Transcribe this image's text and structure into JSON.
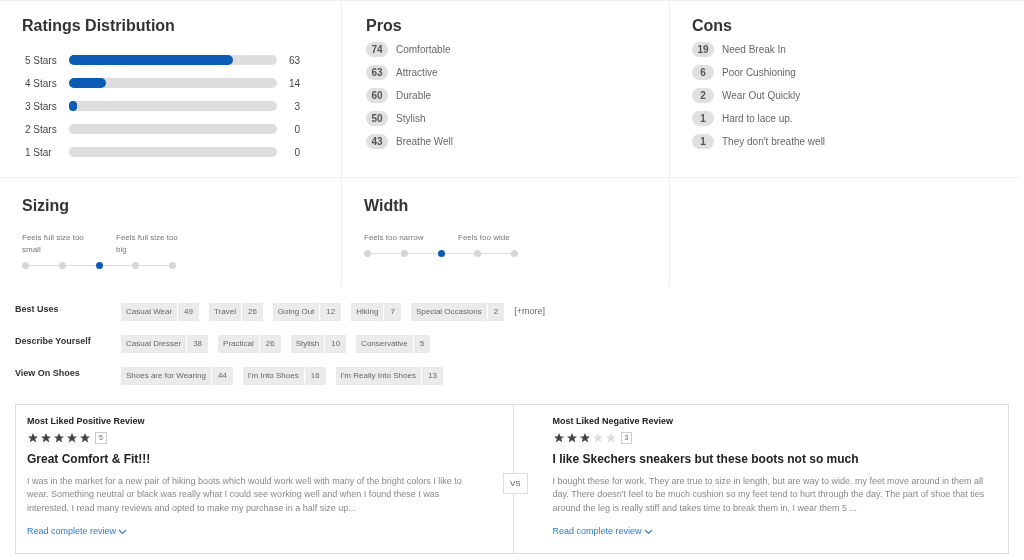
{
  "ratings": {
    "title": "Ratings Distribution",
    "rows": [
      {
        "label": "5 Stars",
        "level": 0.79,
        "count": "63"
      },
      {
        "label": "4 Stars",
        "level": 0.18,
        "count": "14"
      },
      {
        "label": "3 Stars",
        "level": 0.04,
        "count": "3"
      },
      {
        "label": "2 Stars",
        "level": 0,
        "count": "0"
      },
      {
        "label": "1 Star",
        "level": 0,
        "count": "0"
      }
    ]
  },
  "pros": {
    "title": "Pros",
    "items": [
      {
        "count": "74",
        "label": "Comfortable"
      },
      {
        "count": "63",
        "label": "Attractive"
      },
      {
        "count": "60",
        "label": "Durable"
      },
      {
        "count": "50",
        "label": "Stylish"
      },
      {
        "count": "43",
        "label": "Breathe Well"
      }
    ]
  },
  "cons": {
    "title": "Cons",
    "items": [
      {
        "count": "19",
        "label": "Need Break In"
      },
      {
        "count": "6",
        "label": "Poor Cushioning"
      },
      {
        "count": "2",
        "label": "Wear Out Quickly"
      },
      {
        "count": "1",
        "label": "Hard to lace up."
      },
      {
        "count": "1",
        "label": "They don't breathe well"
      }
    ]
  },
  "scales": [
    {
      "title": "Sizing",
      "low_label": "Feels full size too small",
      "high_label": "Feels full size too big",
      "points": [
        {
          "selected": false
        },
        {
          "selected": false
        },
        {
          "selected": true
        },
        {
          "selected": false
        },
        {
          "selected": false
        }
      ]
    },
    {
      "title": "Width",
      "low_label": "Feels too narrow",
      "high_label": "Feels too wide",
      "points": [
        {
          "selected": false
        },
        {
          "selected": false
        },
        {
          "selected": true
        },
        {
          "selected": false
        },
        {
          "selected": false
        }
      ]
    }
  ],
  "tag_groups": [
    {
      "label": "Best Uses",
      "tags": [
        {
          "label": "Casual Wear",
          "count": "49"
        },
        {
          "label": "Travel",
          "count": "26"
        },
        {
          "label": "Going Out",
          "count": "12"
        },
        {
          "label": "Hiking",
          "count": "7"
        },
        {
          "label": "Special Occasions",
          "count": "2"
        }
      ],
      "more": "[+more]"
    },
    {
      "label": "Describe Yourself",
      "tags": [
        {
          "label": "Casual Dresser",
          "count": "38"
        },
        {
          "label": "Practical",
          "count": "26"
        },
        {
          "label": "Stylish",
          "count": "10"
        },
        {
          "label": "Conservative",
          "count": "5"
        }
      ]
    },
    {
      "label": "View On Shoes",
      "tags": [
        {
          "label": "Shoes are for Wearing",
          "count": "44"
        },
        {
          "label": "I'm Into Shoes",
          "count": "16"
        },
        {
          "label": "I'm Really Into Shoes",
          "count": "13"
        }
      ]
    }
  ],
  "reviews": [
    {
      "heading": "Most Liked Positive Review",
      "stars": 5,
      "rating": "5",
      "title": "Great Comfort & Fit!!!",
      "body": "I was in the market for a new pair of hiking boots which would work well with many of the bright colors I like to wear. Something neutral or black was really what I could see working well and when I found these I was interested. I read many reviews and opted to make my purchase in a half size up...",
      "link": "Read complete review"
    },
    {
      "heading": "Most Liked Negative Review",
      "stars": 3,
      "rating": "3",
      "title": "I like Skechers sneakers but these boots not so much",
      "body": "I bought these for work. They are true to size in length, but are way to wide. my feet move around in them all day. There doesn't feel to be much cushion so my feet tend to hurt through the day. The part of shoe that ties around the leg is really stiff and takes time to break them in, I wear them 5 ...",
      "link": "Read complete review"
    }
  ],
  "vs": "VS"
}
